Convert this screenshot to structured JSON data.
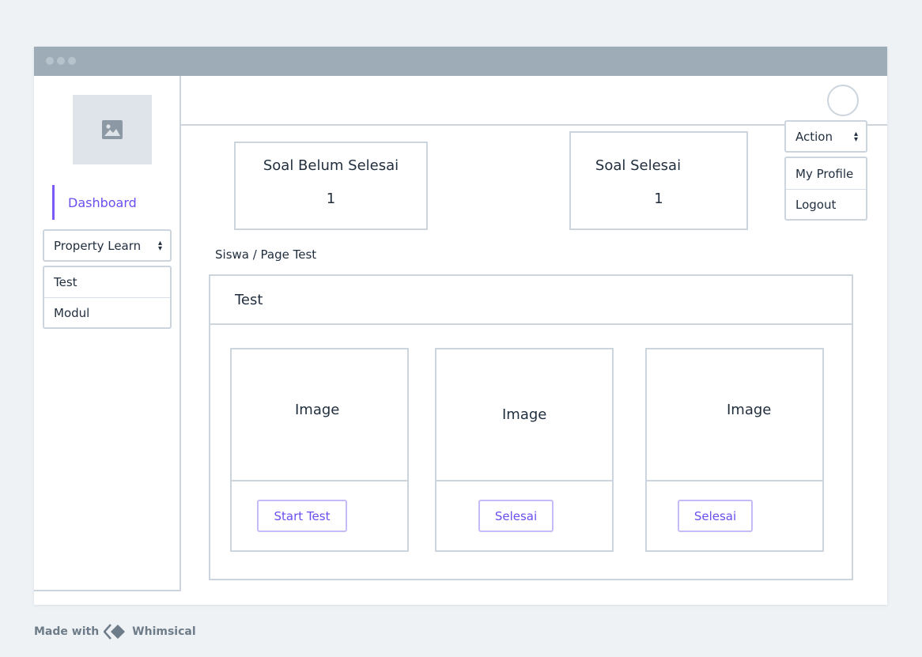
{
  "sidebar": {
    "logo_icon": "image-icon",
    "active_item": "Dashboard",
    "dropdown_label": "Property Learn",
    "menu_items": [
      "Test",
      "Modul"
    ]
  },
  "header": {
    "avatar_icon": "avatar-circle",
    "action_label": "Action",
    "action_menu": [
      "My Profile",
      "Logout"
    ]
  },
  "stats": [
    {
      "label": "Soal Belum Selesai",
      "value": "1"
    },
    {
      "label": "Soal Selesai",
      "value": "1"
    }
  ],
  "breadcrumb": "Siswa / Page Test",
  "panel": {
    "title": "Test",
    "cards": [
      {
        "image_label": "Image",
        "button_label": "Start Test"
      },
      {
        "image_label": "Image",
        "button_label": "Selesai"
      },
      {
        "image_label": "Image",
        "button_label": "Selesai"
      }
    ]
  },
  "footer": {
    "made_with": "Made with",
    "brand": "Whimsical"
  },
  "colors": {
    "accent": "#6b4ef0",
    "border": "#ccd5dd",
    "titlebar": "#9eacb8",
    "background": "#eef2f5"
  }
}
